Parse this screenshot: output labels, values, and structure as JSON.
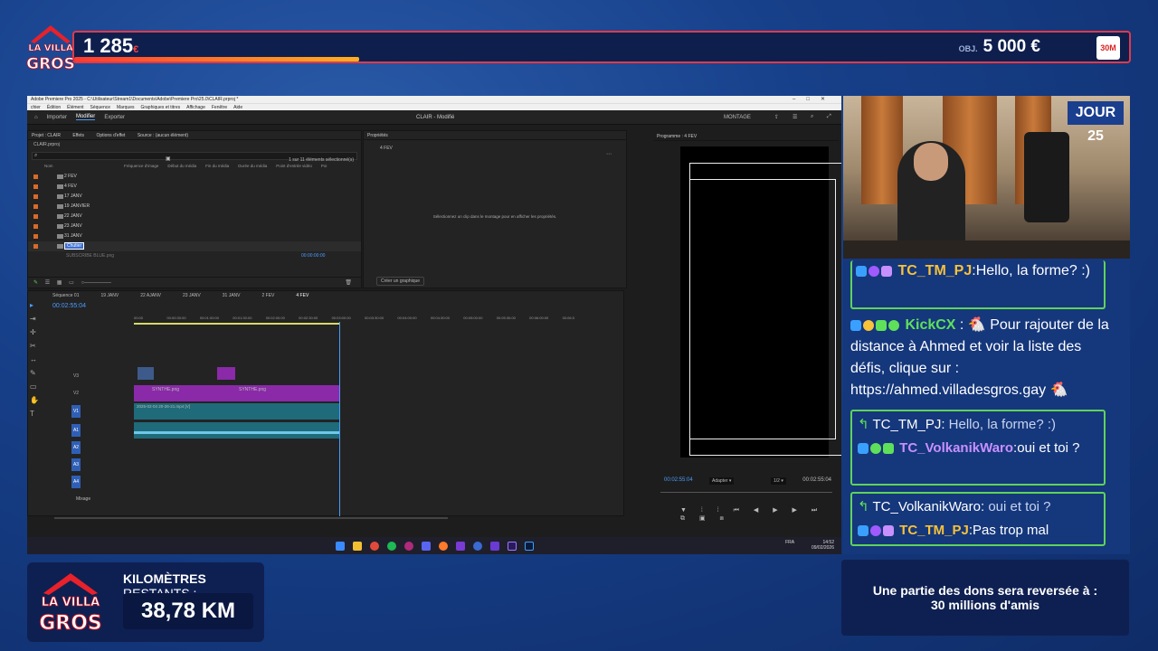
{
  "overlay": {
    "brand_line1": "LA VILLA",
    "brand_line2": "GROS",
    "score": "1 285",
    "score_currency": "€",
    "goal_prefix": "OBJ.",
    "goal": "5 000 €",
    "badge": "30M",
    "progress_fraction": 0.27,
    "accent": "#e03a4a",
    "day": "JOUR 25"
  },
  "premiere": {
    "window_title": "Adobe Premiere Pro 2025 - C:\\Utilisateur\\Stream1\\Documents\\Adobe\\Premiere Pro\\25.0\\CLAIR.prproj *",
    "menu": [
      "chier",
      "Édition",
      "Élément",
      "Séquence",
      "Marques",
      "Graphiques et titres",
      "Affichage",
      "Fenêtre",
      "Aide"
    ],
    "workspace_tabs": [
      "Importer",
      "Modifier",
      "Exporter"
    ],
    "project_title": "CLAIR - Modifié",
    "workspace_label": "MONTAGE",
    "project_panel": {
      "tabs": [
        "Projet : CLAIR",
        "Effets",
        "Options d'effet",
        "Source : (aucun élément)"
      ],
      "file": "CLAIR.prproj",
      "selection_info": "1 sur 11 éléments sélectionné(s)",
      "columns": [
        "Nom",
        "Fréquence d'image",
        "Début du média",
        "Fin du média",
        "Durée du média",
        "Point d'entrée vidéo",
        "Poi"
      ],
      "items": [
        "2 FEV",
        "4 FEV",
        "17 JANV",
        "19 JANVIER",
        "22 JANV",
        "23 JANV",
        "31 JANV",
        "Chutier"
      ],
      "sub_item": "SUBSCRIBE BLUE.png",
      "sub_item_time": "00:00:00:00"
    },
    "properties_panel": {
      "title": "Propriétés",
      "sequence": "4 FEV",
      "hint": "Sélectionnez un clip dans le montage pour en afficher les propriétés.",
      "button": "Créer un graphique"
    },
    "program_monitor": {
      "title": "Programme : 4 FEV",
      "timecode_left": "00:02:55:04",
      "fit": "Adapter",
      "resolution": "1/2",
      "timecode_right": "00:02:55:04"
    },
    "timeline": {
      "tabs": [
        "Séquence 01",
        "19 JANV",
        "22 AJANV",
        "23 JANV",
        "31 JANV",
        "2 FEV",
        "4 FEV"
      ],
      "timecode": "00:02:55:04",
      "ruler": [
        "00:00",
        "00:00:30:00",
        "00:01:00:00",
        "00:01:30:00",
        "00:02:00:00",
        "00:02:30:00",
        "00:03:00:00",
        "00:03:30:00",
        "00:04:00:00",
        "00:04:30:00",
        "00:05:00:00",
        "00:05:30:00",
        "00:06:00:00",
        "00:06:3"
      ],
      "video_tracks": [
        "V3",
        "V2",
        "V1"
      ],
      "audio_tracks": [
        "A1",
        "A2",
        "A3",
        "A4"
      ],
      "mix_label": "Mixage",
      "clip_v2_a": "SYNTHE.png",
      "clip_v2_b": "SYNTHE.png",
      "clip_v1": "2025-02-04 20-26-21.mp4 [V]"
    },
    "tray": {
      "lang": "FRA",
      "time": "14:52",
      "date": "09/02/2026"
    }
  },
  "chat": [
    {
      "badges": [
        "blue",
        "purple",
        "green"
      ],
      "user": "TC_TM_PJ",
      "text": "Hello, la forme? :)"
    },
    {
      "badges": [
        "blue",
        "yellow",
        "green",
        "green"
      ],
      "user": "KickCX",
      "text": "🐔 Pour rajouter de la distance à Ahmed et voir la liste des défis, clique sur : https://ahmed.villadesgros.gay 🐔"
    },
    {
      "reply_to": "TC_TM_PJ:",
      "reply_text": "Hello, la forme? :)",
      "badges": [
        "blue",
        "green",
        "green"
      ],
      "user": "TC_VolkanikWaro",
      "text": "oui et toi ?"
    },
    {
      "reply_to": "TC_VolkanikWaro:",
      "reply_text": "oui et toi ?",
      "badges": [
        "blue",
        "purple",
        "green"
      ],
      "user": "TC_TM_PJ",
      "text": "Pas trop mal"
    }
  ],
  "bottom": {
    "km_title_bold": "KILOMÈTRES",
    "km_title_rest": "RESTANTS :",
    "km_value": "38,78 KM",
    "dons_line1": "Une partie des dons sera reversée à :",
    "dons_line2": "30 millions d'amis"
  }
}
